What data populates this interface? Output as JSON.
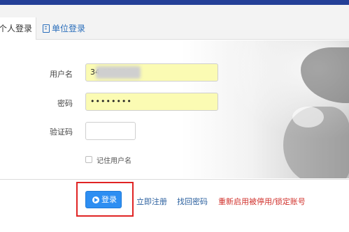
{
  "tabs": {
    "personal_label": "个人登录",
    "unit_label": "单位登录"
  },
  "form": {
    "username_label": "用户名",
    "username_value": "34          053611",
    "password_label": "密码",
    "password_value": "••••••••",
    "captcha_label": "验证码",
    "captcha_value": "",
    "remember_label": "记住用户名",
    "remember_checked": false
  },
  "actions": {
    "login_label": "登录",
    "register_link": "立即注册",
    "recover_link": "找回密码",
    "reenable_link": "重新启用被停用/锁定账号"
  },
  "icons": {
    "unit_tab_icon": "building-icon",
    "login_icon": "sign-in-arrow-icon"
  },
  "colors": {
    "header_bar": "#243f97",
    "login_button": "#2d8ef2",
    "highlight_box": "#e02424",
    "autofill_field": "#fbfbb3",
    "link_blue": "#2a5f9e",
    "link_red": "#d0302b"
  }
}
